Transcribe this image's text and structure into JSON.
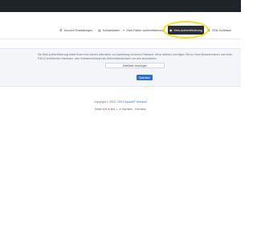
{
  "tabs": [
    {
      "label": "Account Einstellungen",
      "icon": "gear-icon",
      "glyph": "⚙"
    },
    {
      "label": "Kontaktdaten",
      "icon": "id-card-icon",
      "glyph": "▤"
    },
    {
      "label": "Zwei-Faktor-Authentifizierung",
      "icon": "shield-icon",
      "glyph": "◐"
    },
    {
      "label": "Web-Authentifizierung",
      "icon": "fingerprint-icon",
      "glyph": "◉"
    },
    {
      "label": "SSH-Schlüssel",
      "icon": "key-icon",
      "glyph": "⚷"
    }
  ],
  "webauthn": {
    "description": "Die Web-Authentifizierung bietet Ihnen eine sichere Alternative zur Anmeldung mit einem Passwort. Wenn aktiviert, benötigen Sie nur Ihren Benutzernamen und einen FIDO2 zertifizierten Hardware- oder Softwareschlüssel als Sicherheitsschlüssel, um sich anzumelden.",
    "certificate_button": "Zertifikate hinzufügen",
    "save_button": "Speichern"
  },
  "footer": {
    "copyright_prefix": "Copyright © 2015 - ",
    "copyright_link": "2023 SysAdt!T Services",
    "made_prefix": "Made with",
    "made_middle": "and",
    "made_suffix": "in Sachsen - Germany"
  },
  "colors": {
    "topbar": "#1f232a",
    "active_tab": "#2b2e34",
    "accent": "#2b6fd6",
    "highlight": "#f4e20f"
  }
}
